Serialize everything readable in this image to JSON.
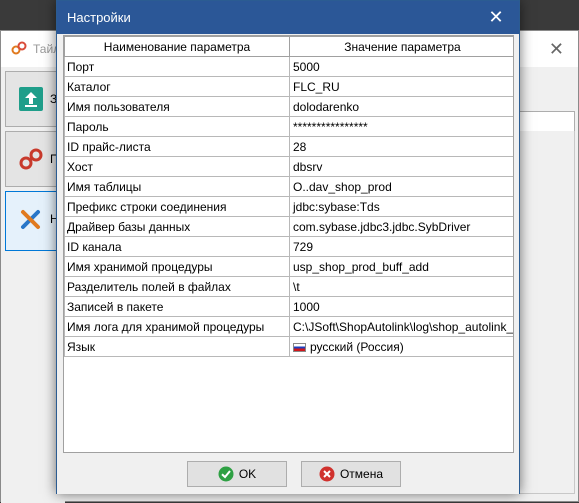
{
  "background_window": {
    "title": "Тайл",
    "side_buttons": [
      {
        "label": "За"
      },
      {
        "label": "П"
      },
      {
        "label": "На"
      }
    ]
  },
  "dialog": {
    "title": "Настройки",
    "close_glyph": "✕",
    "columns": [
      "Наименование параметра",
      "Значение параметра"
    ],
    "rows": [
      {
        "name": "Порт",
        "value": "5000"
      },
      {
        "name": "Каталог",
        "value": "FLC_RU"
      },
      {
        "name": "Имя пользователя",
        "value": "dolodarenko"
      },
      {
        "name": "Пароль",
        "value": "****************"
      },
      {
        "name": "ID прайс-листа",
        "value": "28"
      },
      {
        "name": "Хост",
        "value": "dbsrv"
      },
      {
        "name": "Имя таблицы",
        "value": "O..dav_shop_prod"
      },
      {
        "name": "Префикс строки соединения",
        "value": "jdbc:sybase:Tds"
      },
      {
        "name": "Драйвер базы данных",
        "value": "com.sybase.jdbc3.jdbc.SybDriver"
      },
      {
        "name": "ID канала",
        "value": "729"
      },
      {
        "name": "Имя хранимой процедуры",
        "value": "usp_shop_prod_buff_add"
      },
      {
        "name": "Разделитель полей в файлах",
        "value": "\\t"
      },
      {
        "name": "Записей в пакете",
        "value": "1000"
      },
      {
        "name": "Имя лога для хранимой процедуры",
        "value": "C:\\JSoft\\ShopAutolink\\log\\shop_autolink_re..."
      },
      {
        "name": "Язык",
        "value": "русский (Россия)"
      }
    ],
    "ok_label": "OK",
    "cancel_label": "Отмена"
  },
  "colors": {
    "titlebar": "#2b5797",
    "ok_icon": "#2ea043",
    "cancel_icon": "#d0312d"
  },
  "icons": {
    "upload": "upload-icon",
    "link": "link-icon",
    "tools": "tools-icon",
    "flag": "russia-flag-icon",
    "ok": "check-circle-icon",
    "cancel": "x-circle-icon"
  }
}
